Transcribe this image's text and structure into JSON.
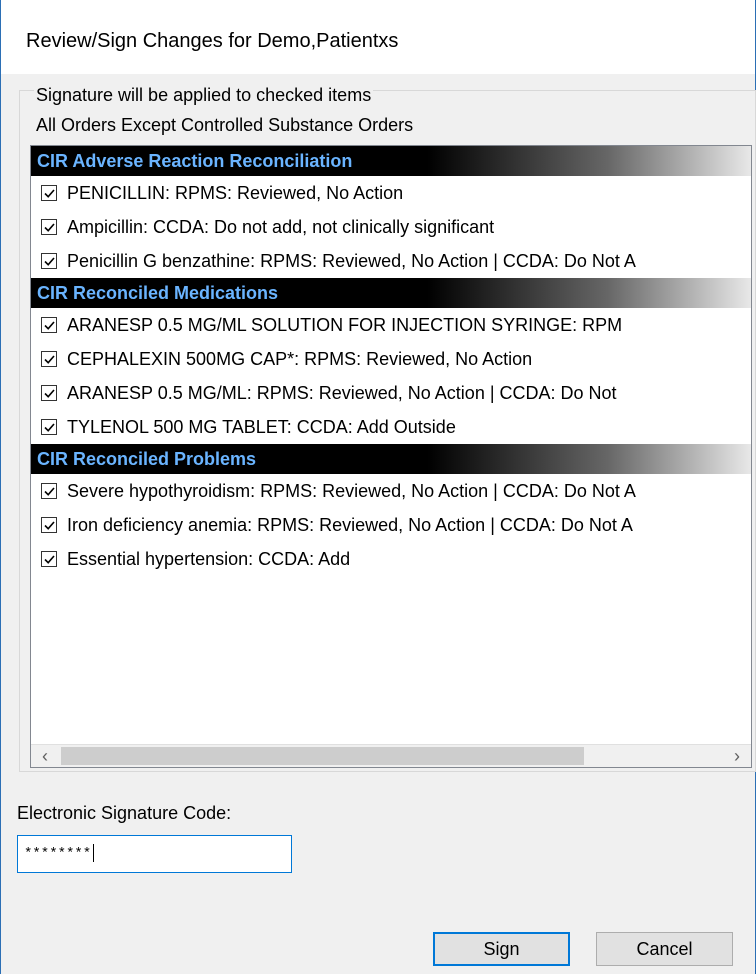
{
  "window": {
    "title": "Review/Sign Changes for Demo,Patientxs"
  },
  "group": {
    "caption": "Signature will be applied to checked items",
    "subcaption": "All Orders Except Controlled Substance Orders"
  },
  "sections": [
    {
      "header": "CIR Adverse Reaction Reconciliation",
      "items": [
        {
          "label": "PENICILLIN: RPMS: Reviewed, No Action",
          "checked": true
        },
        {
          "label": "Ampicillin: CCDA: Do not add, not clinically significant",
          "checked": true
        },
        {
          "label": "Penicillin G benzathine: RPMS: Reviewed, No Action | CCDA: Do Not A",
          "checked": true
        }
      ]
    },
    {
      "header": "CIR Reconciled Medications",
      "items": [
        {
          "label": "ARANESP 0.5 MG/ML SOLUTION FOR INJECTION SYRINGE: RPM",
          "checked": true
        },
        {
          "label": "CEPHALEXIN 500MG CAP*: RPMS: Reviewed, No Action",
          "checked": true
        },
        {
          "label": "ARANESP 0.5 MG/ML: RPMS: Reviewed, No Action | CCDA: Do Not",
          "checked": true
        },
        {
          "label": "TYLENOL 500 MG TABLET: CCDA: Add Outside",
          "checked": true
        }
      ]
    },
    {
      "header": "CIR Reconciled Problems",
      "items": [
        {
          "label": "Severe hypothyroidism: RPMS: Reviewed, No Action | CCDA: Do Not A",
          "checked": true
        },
        {
          "label": "Iron deficiency anemia: RPMS: Reviewed, No Action | CCDA: Do Not A",
          "checked": true
        },
        {
          "label": "Essential hypertension: CCDA: Add",
          "checked": true
        }
      ]
    }
  ],
  "scrollbar": {
    "left_glyph": "‹",
    "right_glyph": "›"
  },
  "esig": {
    "label": "Electronic Signature Code:",
    "value": "********"
  },
  "buttons": {
    "sign": "Sign",
    "cancel": "Cancel"
  }
}
